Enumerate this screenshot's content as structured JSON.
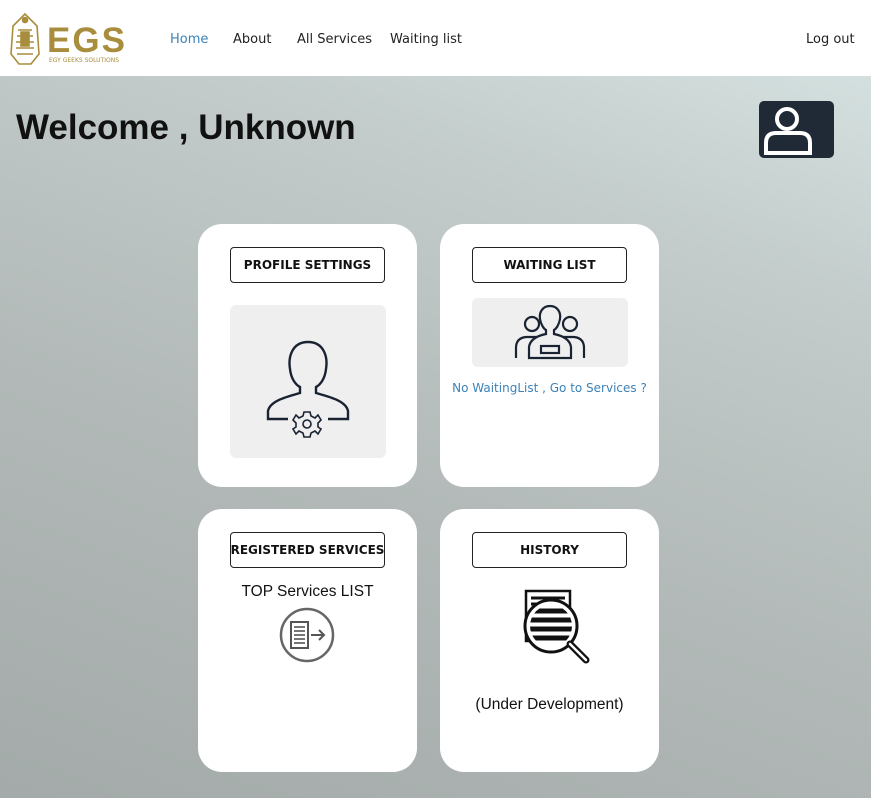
{
  "nav": {
    "logo_text": "EGS",
    "logo_subtitle": "EGY GEEKS SOLUTIONS",
    "links": [
      "Home",
      "About",
      "All Services",
      "Waiting list"
    ],
    "active": "Home",
    "logout": "Log out"
  },
  "welcome": "Welcome , Unknown",
  "cards": {
    "profile": {
      "button": "PROFILE SETTINGS",
      "icon": "user-settings-icon"
    },
    "waiting": {
      "button": "WAITING LIST",
      "icon": "users-group-icon",
      "link": "No WaitingList , Go to Services ?"
    },
    "registered": {
      "button": "REGISTERED SERVICES",
      "text": "TOP Services LIST",
      "icon": "list-arrow-icon"
    },
    "history": {
      "button": "HISTORY",
      "icon": "search-document-icon",
      "text": "(Under Development)"
    }
  },
  "colors": {
    "accent": "#3d82b7",
    "logo_gold": "#a88d3c",
    "avatar_bg": "#1f2a36"
  }
}
